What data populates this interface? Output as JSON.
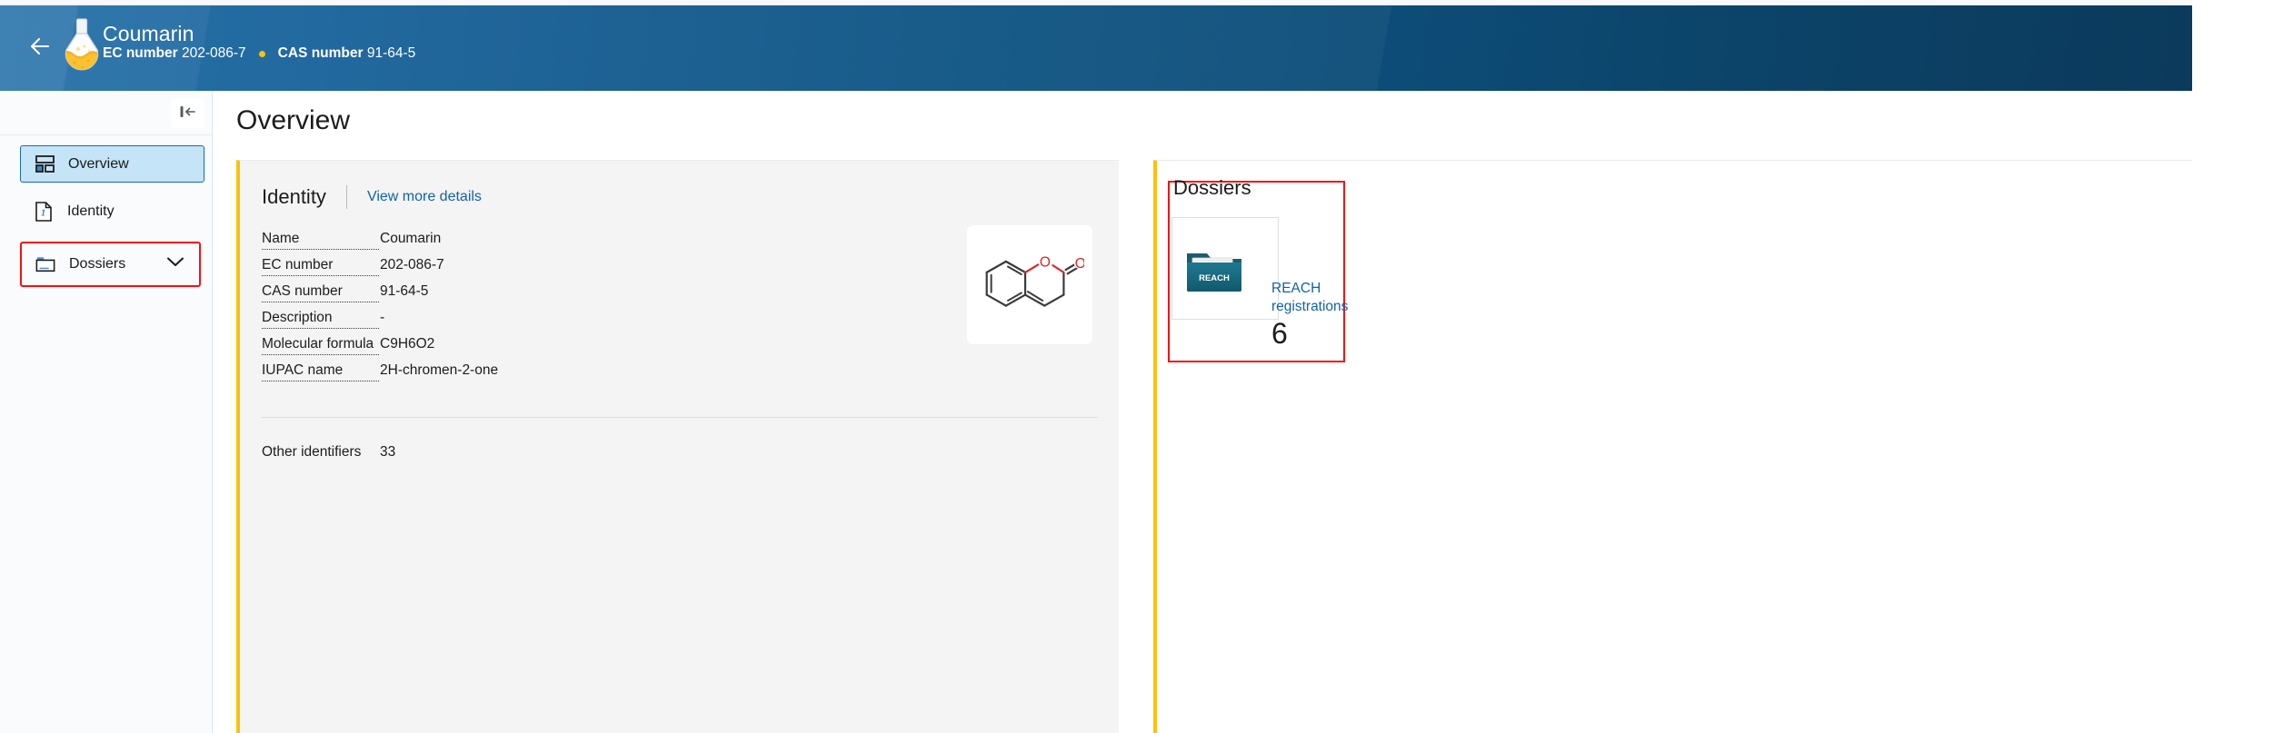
{
  "header": {
    "back_icon": "back-arrow-icon",
    "substance_icon": "flask-icon",
    "title": "Coumarin",
    "ec_label": "EC number",
    "ec_value": "202-086-7",
    "cas_label": "CAS number",
    "cas_value": "91-64-5",
    "separator_color": "#ffc107",
    "gradient_from": "#1b6ba6",
    "gradient_to": "#0b3a5c"
  },
  "sidebar": {
    "collapse_icon": "collapse-sidebar-icon",
    "items": [
      {
        "label": "Overview",
        "icon": "layout-overview-icon",
        "active": true
      },
      {
        "label": "Identity",
        "icon": "document-identity-icon",
        "active": false
      },
      {
        "label": "Dossiers",
        "icon": "folder-icon",
        "active": false,
        "expandable": true,
        "chevron": "chevron-down-icon",
        "highlight_color": "#f41212"
      }
    ]
  },
  "main": {
    "page_title": "Overview",
    "identity_card": {
      "title": "Identity",
      "link_label": "View more details",
      "accent_color": "#ffc107",
      "fields": [
        {
          "label": "Name",
          "value": "Coumarin"
        },
        {
          "label": "EC number",
          "value": "202-086-7"
        },
        {
          "label": "CAS number",
          "value": "91-64-5"
        },
        {
          "label": "Description",
          "value": "-"
        },
        {
          "label": "Molecular formula",
          "value": "C9H6O2"
        },
        {
          "label": "IUPAC name",
          "value": "2H-chromen-2-one"
        }
      ],
      "other_identifiers_label": "Other identifiers",
      "other_identifiers_value": "33",
      "structure_icon": "molecular-structure-image"
    },
    "dossiers_card": {
      "title": "Dossiers",
      "accent_color": "#ffc107",
      "highlight_color": "#f41212",
      "tile": {
        "folder_icon": "reach-folder-icon",
        "folder_label": "REACH",
        "link_label": "REACH registrations",
        "count": "6"
      }
    }
  }
}
